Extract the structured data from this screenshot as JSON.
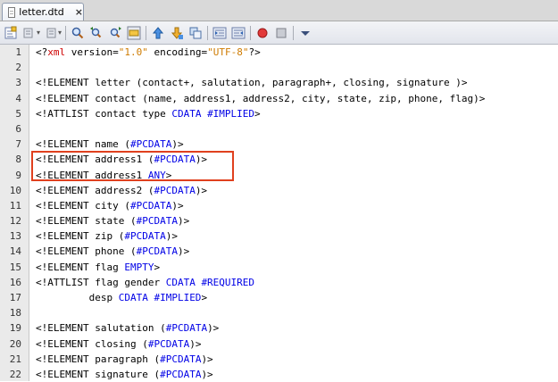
{
  "tab": {
    "label": "letter.dtd",
    "close": "×"
  },
  "toolbar": {
    "icons": [
      "source-history-icon",
      "back-icon",
      "forward-icon",
      "find-icon",
      "find-previous-icon",
      "find-next-icon",
      "toggle-highlight-icon",
      "previous-bookmark-icon",
      "next-bookmark-icon",
      "toggle-bookmark-icon",
      "shift-left-icon",
      "shift-right-icon",
      "start-macro-icon",
      "stop-macro-icon",
      "check-dtd-icon"
    ]
  },
  "editor": {
    "lines": [
      {
        "n": "1",
        "segs": [
          [
            "",
            "<?"
          ],
          [
            "pi",
            "xml"
          ],
          [
            "",
            " version="
          ],
          [
            "str",
            "\"1.0\""
          ],
          [
            "",
            " encoding="
          ],
          [
            "str",
            "\"UTF-8\""
          ],
          [
            "",
            "?>"
          ]
        ]
      },
      {
        "n": "2",
        "segs": []
      },
      {
        "n": "3",
        "segs": [
          [
            "",
            "<!ELEMENT letter (contact+, salutation, paragraph+, closing, signature )>"
          ]
        ]
      },
      {
        "n": "4",
        "segs": [
          [
            "",
            "<!ELEMENT contact (name, address1, address2, city, state, zip, phone, flag)>"
          ]
        ]
      },
      {
        "n": "5",
        "segs": [
          [
            "",
            "<!ATTLIST contact type "
          ],
          [
            "kw",
            "CDATA #IMPLIED"
          ],
          [
            "",
            ">"
          ]
        ]
      },
      {
        "n": "6",
        "segs": []
      },
      {
        "n": "7",
        "segs": [
          [
            "",
            "<!ELEMENT name ("
          ],
          [
            "kw",
            "#PCDATA"
          ],
          [
            "",
            ")>"
          ]
        ]
      },
      {
        "n": "8",
        "segs": [
          [
            "",
            "<!ELEMENT address1 ("
          ],
          [
            "kw",
            "#PCDATA"
          ],
          [
            "",
            ")>"
          ]
        ]
      },
      {
        "n": "9",
        "segs": [
          [
            "",
            "<!ELEMENT address1 "
          ],
          [
            "kw",
            "ANY"
          ],
          [
            "",
            ">"
          ]
        ]
      },
      {
        "n": "10",
        "segs": [
          [
            "",
            "<!ELEMENT address2 ("
          ],
          [
            "kw",
            "#PCDATA"
          ],
          [
            "",
            ")>"
          ]
        ]
      },
      {
        "n": "11",
        "segs": [
          [
            "",
            "<!ELEMENT city ("
          ],
          [
            "kw",
            "#PCDATA"
          ],
          [
            "",
            ")>"
          ]
        ]
      },
      {
        "n": "12",
        "segs": [
          [
            "",
            "<!ELEMENT state ("
          ],
          [
            "kw",
            "#PCDATA"
          ],
          [
            "",
            ")>"
          ]
        ]
      },
      {
        "n": "13",
        "segs": [
          [
            "",
            "<!ELEMENT zip ("
          ],
          [
            "kw",
            "#PCDATA"
          ],
          [
            "",
            ")>"
          ]
        ]
      },
      {
        "n": "14",
        "segs": [
          [
            "",
            "<!ELEMENT phone ("
          ],
          [
            "kw",
            "#PCDATA"
          ],
          [
            "",
            ")>"
          ]
        ]
      },
      {
        "n": "15",
        "segs": [
          [
            "",
            "<!ELEMENT flag "
          ],
          [
            "kw",
            "EMPTY"
          ],
          [
            "",
            ">"
          ]
        ]
      },
      {
        "n": "16",
        "segs": [
          [
            "",
            "<!ATTLIST flag gender "
          ],
          [
            "kw",
            "CDATA #REQUIRED"
          ]
        ]
      },
      {
        "n": "17",
        "segs": [
          [
            "",
            "         desp "
          ],
          [
            "kw",
            "CDATA #IMPLIED"
          ],
          [
            "",
            ">"
          ]
        ]
      },
      {
        "n": "18",
        "segs": []
      },
      {
        "n": "19",
        "segs": [
          [
            "",
            "<!ELEMENT salutation ("
          ],
          [
            "kw",
            "#PCDATA"
          ],
          [
            "",
            ")>"
          ]
        ]
      },
      {
        "n": "20",
        "segs": [
          [
            "",
            "<!ELEMENT closing ("
          ],
          [
            "kw",
            "#PCDATA"
          ],
          [
            "",
            ")>"
          ]
        ]
      },
      {
        "n": "21",
        "segs": [
          [
            "",
            "<!ELEMENT paragraph ("
          ],
          [
            "kw",
            "#PCDATA"
          ],
          [
            "",
            ")>"
          ]
        ]
      },
      {
        "n": "22",
        "segs": [
          [
            "",
            "<!ELEMENT signature ("
          ],
          [
            "kw",
            "#PCDATA"
          ],
          [
            "",
            ")>"
          ]
        ]
      }
    ]
  },
  "colors": {
    "highlight_box": "#e0401e",
    "keyword": "#0000e6",
    "string": "#ce7b00",
    "pi_name": "#ce0000"
  }
}
